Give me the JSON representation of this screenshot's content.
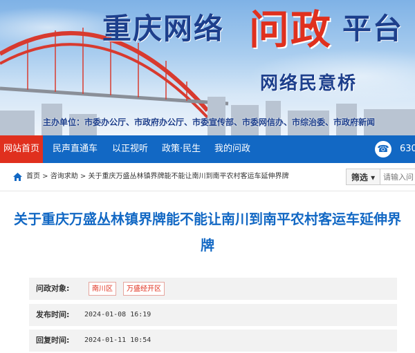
{
  "banner": {
    "title_left": "重庆网络",
    "title_highlight": "问政",
    "title_right": "平台",
    "subtitle": "网络民意桥",
    "sponsor": "主办单位：市委办公厅、市政府办公厅、市委宣传部、市委网信办、市综治委、市政府新闻"
  },
  "nav": {
    "items": [
      "网站首页",
      "民声直通车",
      "以正视听",
      "政策·民生",
      "我的问政"
    ],
    "phone": "630"
  },
  "breadcrumb": "首页 > 咨询求助 > 关于重庆万盛丛林镇界牌能不能让南川到南平农村客运车延伸界牌",
  "filter_label": "筛选",
  "search_placeholder": "请输入问",
  "article": {
    "title": "关于重庆万盛丛林镇界牌能不能让南川到南平农村客运车延伸界牌",
    "target_label": "问政对象:",
    "targets": [
      "南川区",
      "万盛经开区"
    ],
    "published_label": "发布时间:",
    "published": "2024-01-08 16:19",
    "replied_label": "回复时间:",
    "replied": "2024-01-11 10:54"
  },
  "colors": {
    "nav_blue": "#1268c4",
    "accent_red": "#e0301e",
    "title_blue": "#1d3f8c"
  }
}
